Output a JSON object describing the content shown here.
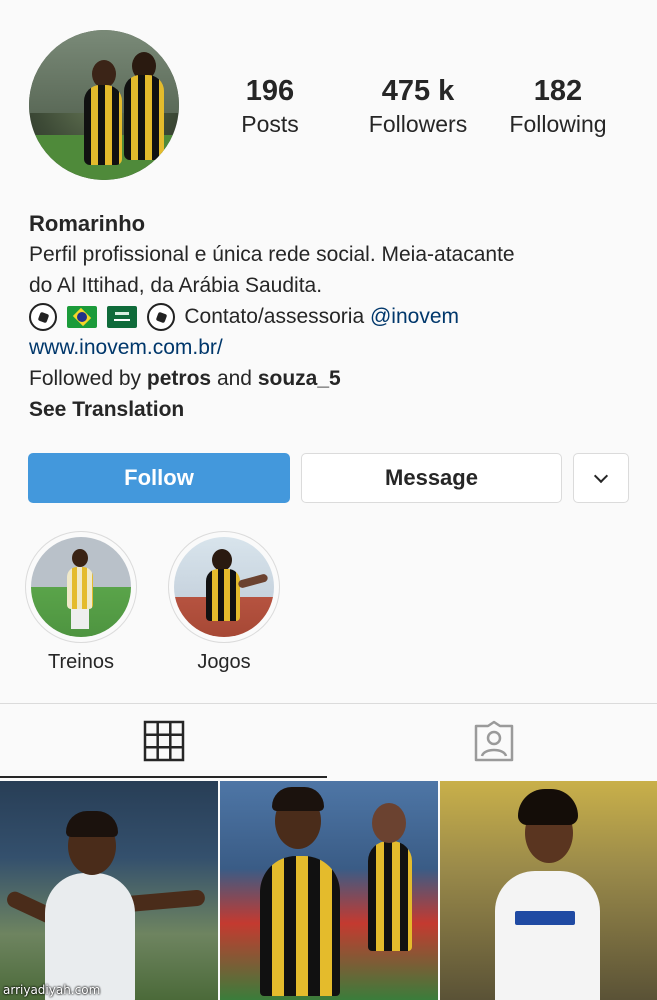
{
  "profile": {
    "username": "Romarinho",
    "bio_line1": "Perfil profissional e única rede social. Meia-atacante",
    "bio_line2": "do Al Ittihad, da Arábia Saudita.",
    "contact_text": "Contato/assessoria",
    "mention": "@inovem",
    "website": "www.inovem.com.br/",
    "followed_by_prefix": "Followed by",
    "followed_by_user1": "petros",
    "followed_by_and": "and",
    "followed_by_user2": "souza_5",
    "see_translation": "See Translation",
    "emoji_icons": [
      "soccer-ball-icon",
      "brazil-flag-icon",
      "saudi-flag-icon",
      "soccer-ball-icon"
    ]
  },
  "stats": [
    {
      "value": "196",
      "label": "Posts"
    },
    {
      "value": "475 k",
      "label": "Followers"
    },
    {
      "value": "182",
      "label": "Following"
    }
  ],
  "actions": {
    "follow": "Follow",
    "message": "Message",
    "more_icon": "chevron-down-icon"
  },
  "highlights": [
    {
      "label": "Treinos"
    },
    {
      "label": "Jogos"
    }
  ],
  "tabs": {
    "grid_icon": "grid-icon",
    "tagged_icon": "tagged-person-icon",
    "active": "grid"
  },
  "watermark": "arriyadiyah.com",
  "colors": {
    "follow_button": "#4398dc",
    "link": "#00376b",
    "border": "#dbdbdb",
    "background": "#fafafa"
  }
}
